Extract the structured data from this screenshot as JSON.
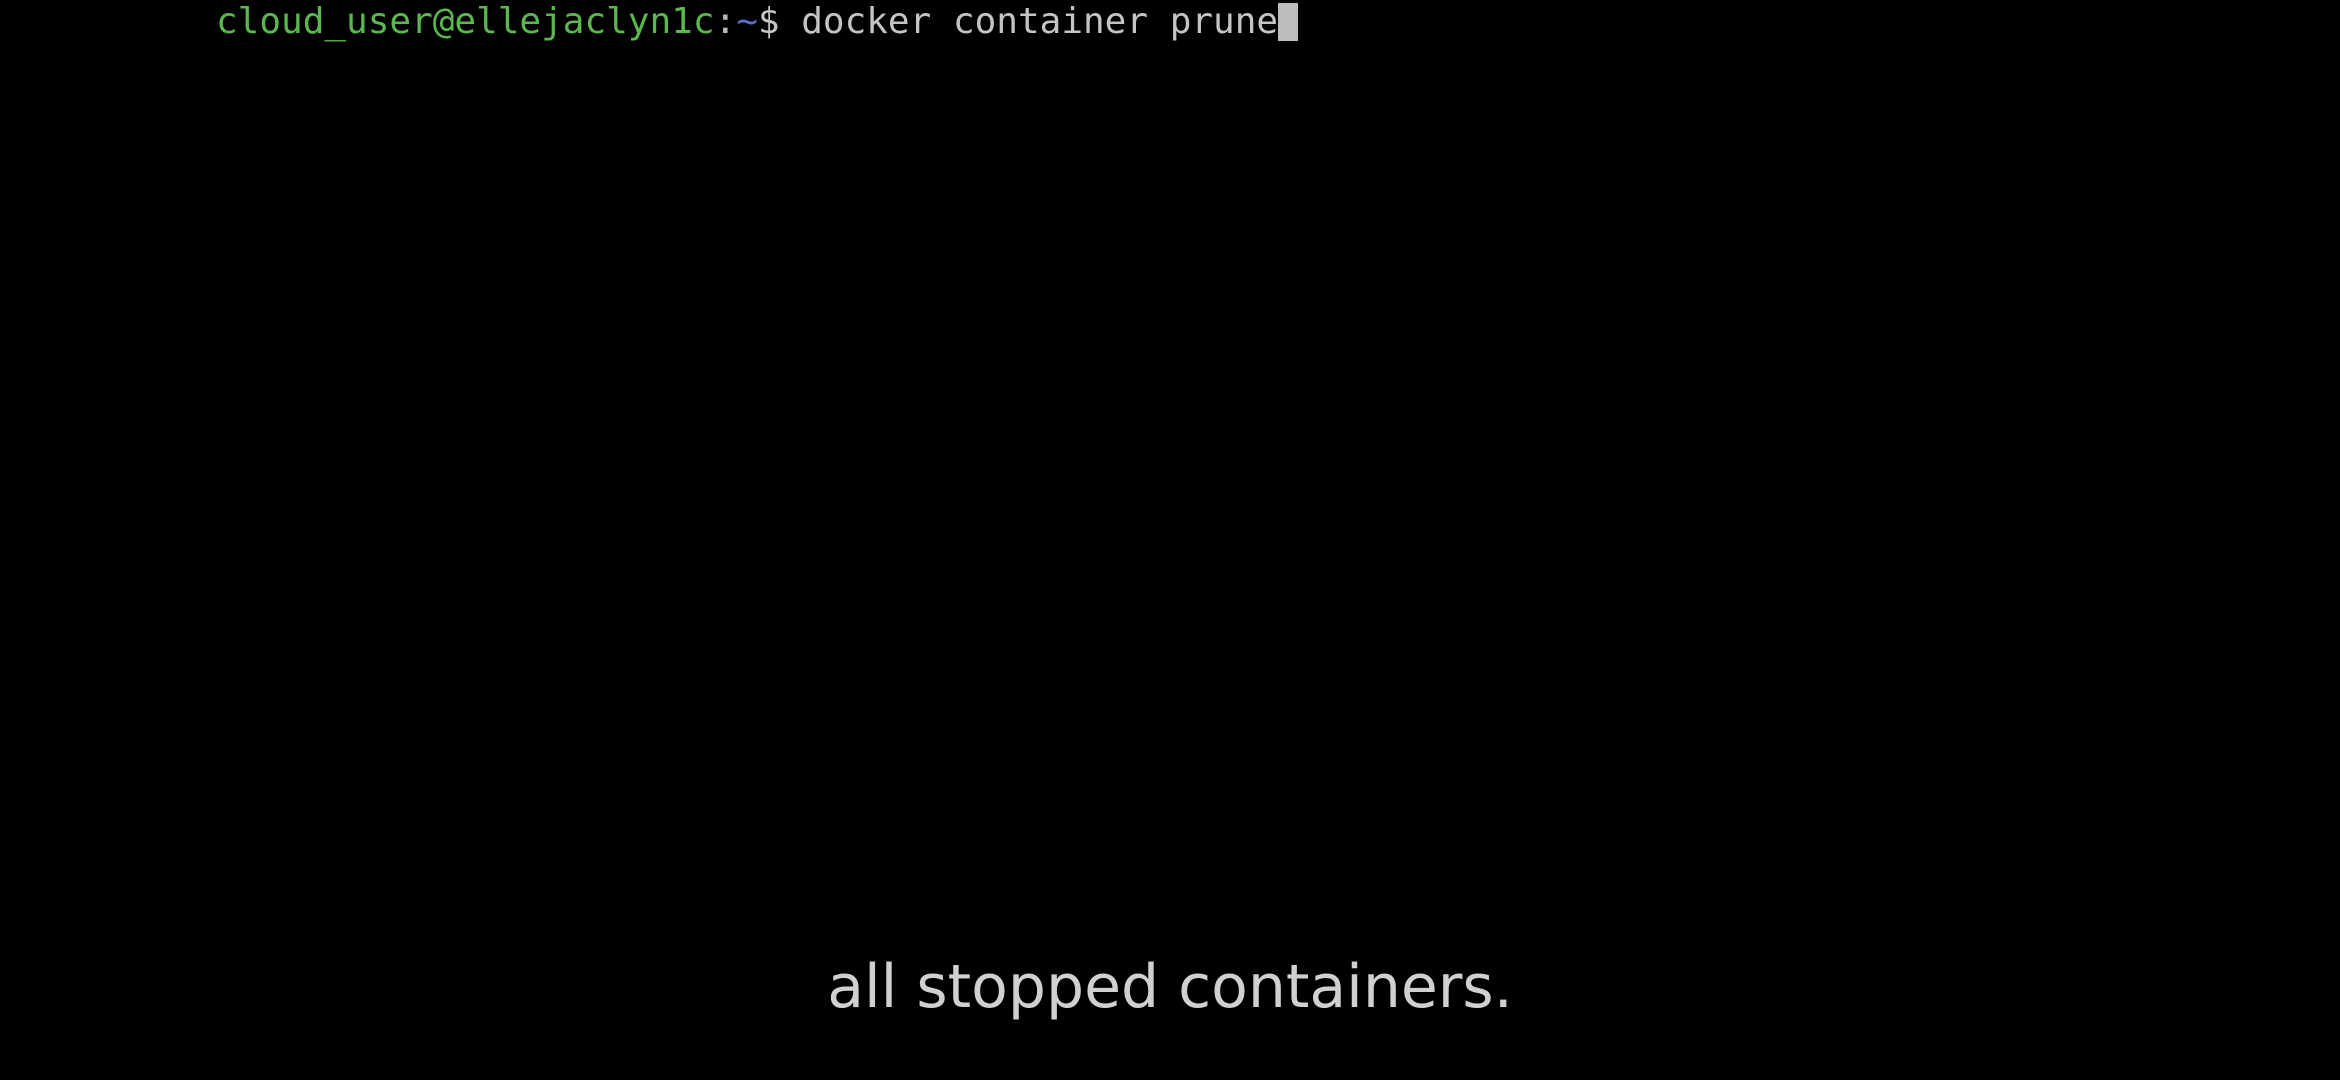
{
  "terminal": {
    "prompt": {
      "user_host": "cloud_user@ellejaclyn1c",
      "separator": ":",
      "path": "~",
      "symbol": "$"
    },
    "command": " docker container prune"
  },
  "subtitle": {
    "text": "all stopped containers."
  },
  "colors": {
    "background": "#000000",
    "user_host": "#5bb84f",
    "path": "#5a6fd0",
    "text": "#c4c4c4"
  }
}
